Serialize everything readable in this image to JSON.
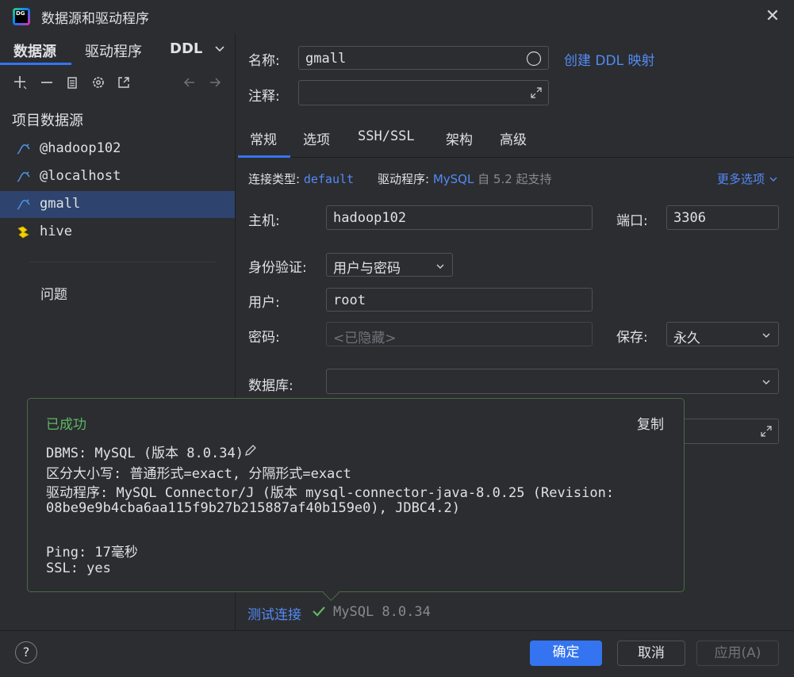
{
  "window": {
    "title": "数据源和驱动程序"
  },
  "left": {
    "tabs": [
      "数据源",
      "驱动程序",
      "DDL"
    ],
    "section_title": "项目数据源",
    "datasources": [
      {
        "label": "@hadoop102",
        "icon": "mysql-icon"
      },
      {
        "label": "@localhost",
        "icon": "mysql-icon"
      },
      {
        "label": "gmall",
        "icon": "mysql-icon",
        "selected": true
      },
      {
        "label": "hive",
        "icon": "hive-icon"
      }
    ],
    "problems": "问题"
  },
  "header": {
    "name_label": "名称:",
    "name_value": "gmall",
    "ddl_link": "创建 DDL 映射",
    "comment_label": "注释:"
  },
  "tabs": [
    "常规",
    "选项",
    "SSH/SSL",
    "架构",
    "高级"
  ],
  "conn": {
    "type_label": "连接类型:",
    "type_value": "default",
    "driver_label": "驱动程序:",
    "driver_value": "MySQL",
    "driver_note": "自 5.2 起支持",
    "more_options": "更多选项"
  },
  "form": {
    "host_label": "主机:",
    "host_value": "hadoop102",
    "port_label": "端口:",
    "port_value": "3306",
    "auth_label": "身份验证:",
    "auth_value": "用户与密码",
    "user_label": "用户:",
    "user_value": "root",
    "password_label": "密码:",
    "password_placeholder": "<已隐藏>",
    "save_label": "保存:",
    "save_value": "永久",
    "database_label": "数据库:"
  },
  "tooltip": {
    "status": "已成功",
    "copy": "复制",
    "lines": [
      "DBMS: MySQL (版本 8.0.34)",
      "区分大小写: 普通形式=exact, 分隔形式=exact",
      "驱动程序: MySQL Connector/J (版本 mysql-connector-java-8.0.25 (Revision:",
      "08be9e9b4cba6aa115f9b27b215887af40b159e0), JDBC4.2)",
      "Ping: 17毫秒",
      "SSL: yes"
    ]
  },
  "test": {
    "link": "测试连接",
    "result": "MySQL 8.0.34"
  },
  "footer": {
    "help": "?",
    "ok": "确定",
    "cancel": "取消",
    "apply": "应用(A)"
  },
  "colors": {
    "accent": "#3574f0",
    "link": "#548af7",
    "success": "#5fb865",
    "selected_row": "#2e436e"
  }
}
